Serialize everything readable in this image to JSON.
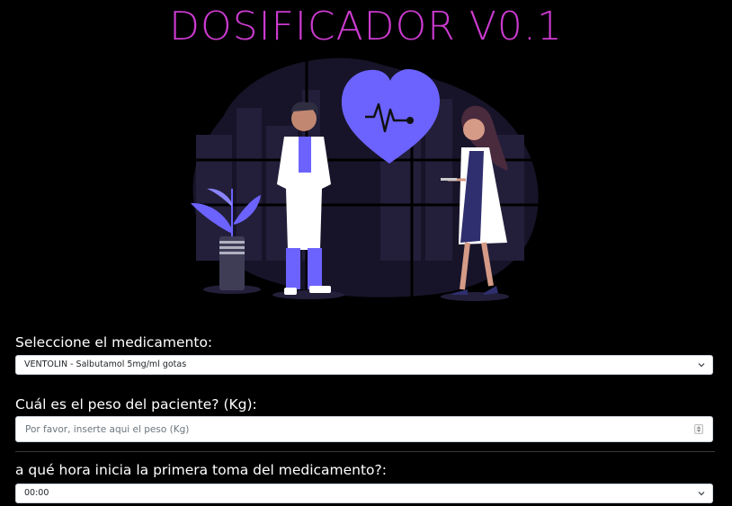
{
  "header": {
    "title": "DOSIFICADOR V0.1"
  },
  "hero": {
    "image_icon": "medical-team-heart-illustration"
  },
  "medication": {
    "label": "Seleccione el medicamento:",
    "selected": "VENTOLIN - Salbutamol 5mg/ml gotas"
  },
  "weight": {
    "label": "Cuál es el peso del paciente? (Kg):",
    "value": "",
    "placeholder": "Por favor, inserte aqui el peso (Kg)"
  },
  "start_time": {
    "label": "a qué hora inicia la primera toma del medicamento?:",
    "selected": "00:00"
  },
  "colors": {
    "background": "#000000",
    "title": "#cc3bd0",
    "accent": "#6c63ff"
  }
}
